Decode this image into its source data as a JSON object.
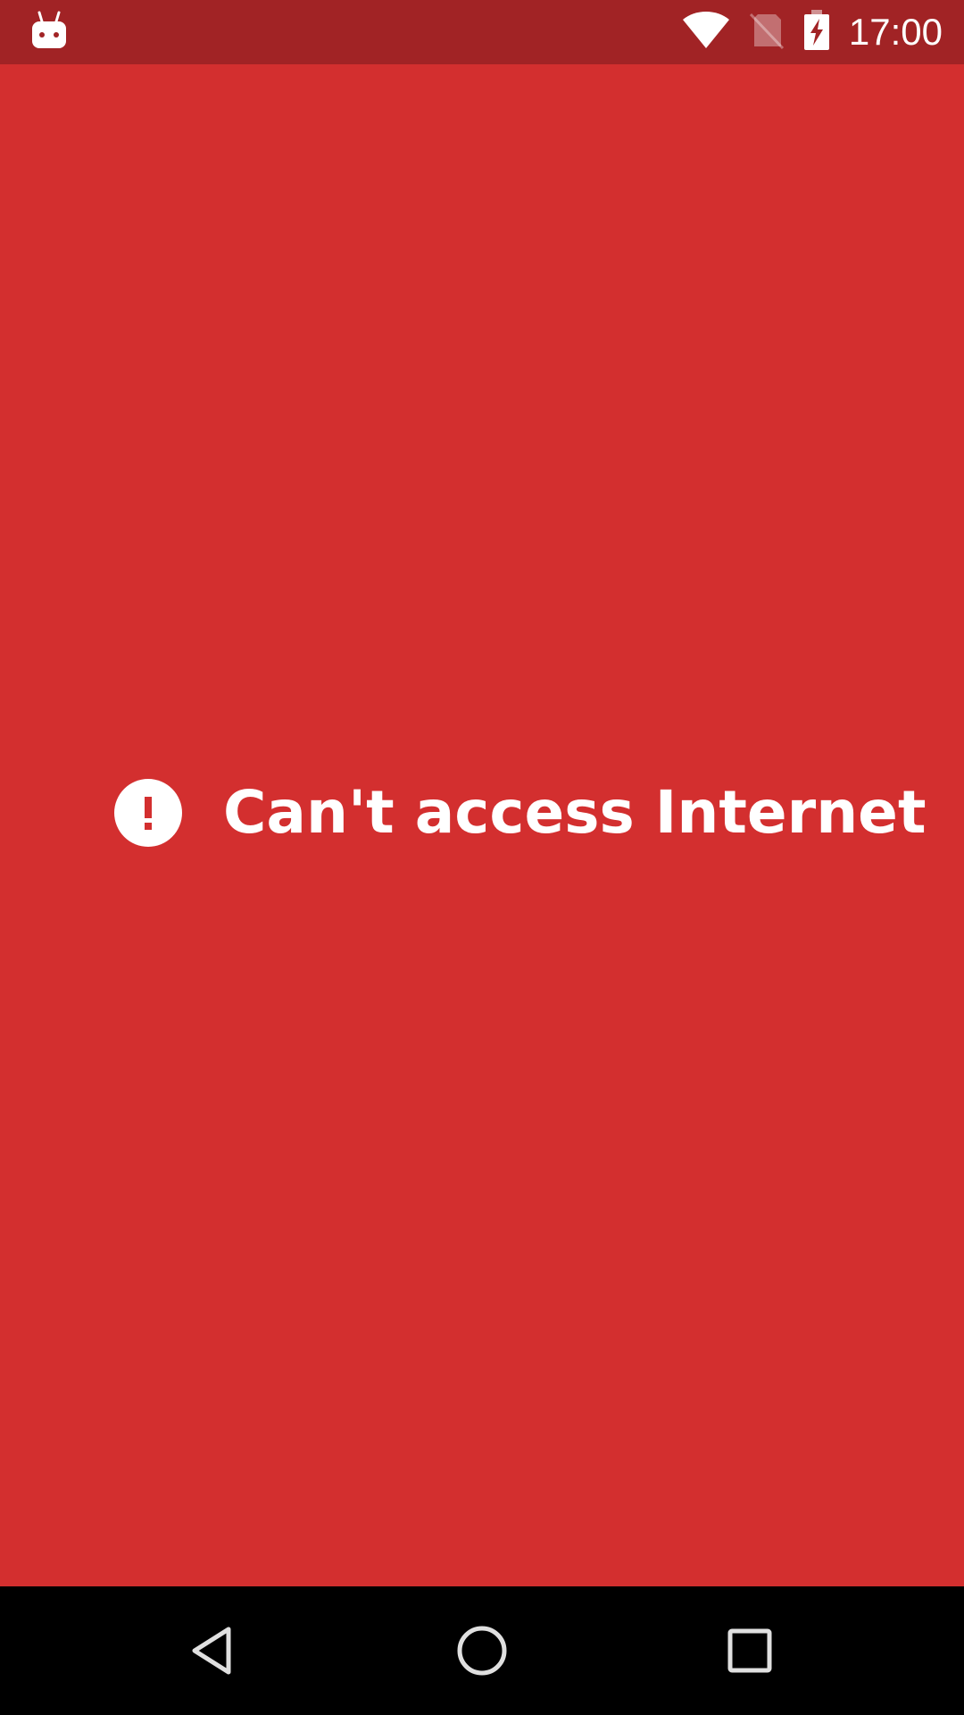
{
  "status_bar": {
    "time": "17:00",
    "icons": [
      "android-debug-icon",
      "wifi-icon",
      "no-sim-icon",
      "battery-charging-icon"
    ]
  },
  "main": {
    "message": "Can't access Internet",
    "icon": "alert-circle-icon"
  },
  "navigation": {
    "buttons": [
      "back-icon",
      "home-icon",
      "recents-icon"
    ]
  },
  "colors": {
    "background": "#d32f2f",
    "status_bar": "#a12325",
    "foreground": "#ffffff",
    "nav_bar": "#000000"
  }
}
